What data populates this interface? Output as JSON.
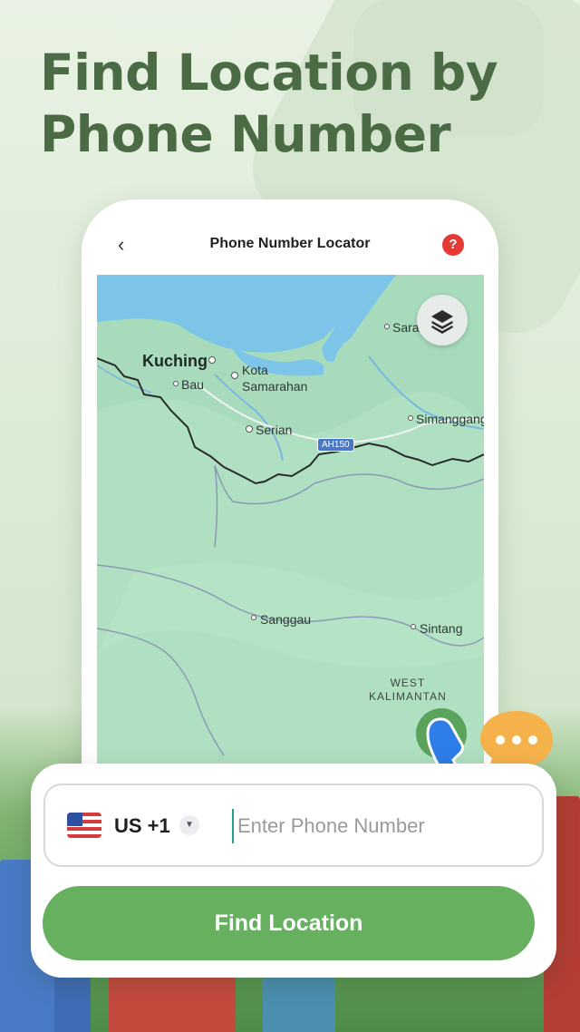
{
  "headline": {
    "line1": "Find Location by",
    "line2": "Phone Number"
  },
  "header": {
    "title": "Phone Number Locator",
    "back_icon": "chevron-left-icon",
    "help_glyph": "?"
  },
  "map": {
    "labels": {
      "kuching": "Kuching",
      "bau": "Bau",
      "kota": "Kota\nSamarahan",
      "serian": "Serian",
      "sara": "Sara",
      "simanggang": "Simanggang",
      "sanggau": "Sanggau",
      "sintang": "Sintang",
      "region": "WEST\nKALIMANTAN",
      "road": "AH150"
    },
    "colors": {
      "land": "#a8dbbc",
      "water": "#7cc4e8"
    }
  },
  "form": {
    "country_code": "US +1",
    "phone_placeholder": "Enter Phone Number",
    "phone_value": "",
    "find_button": "Find Location"
  },
  "colors": {
    "accent": "#66b060",
    "headline": "#4b6b45",
    "help": "#e53935",
    "call_icon": "#2f7de8",
    "chat_bubble": "#f6b24a"
  }
}
